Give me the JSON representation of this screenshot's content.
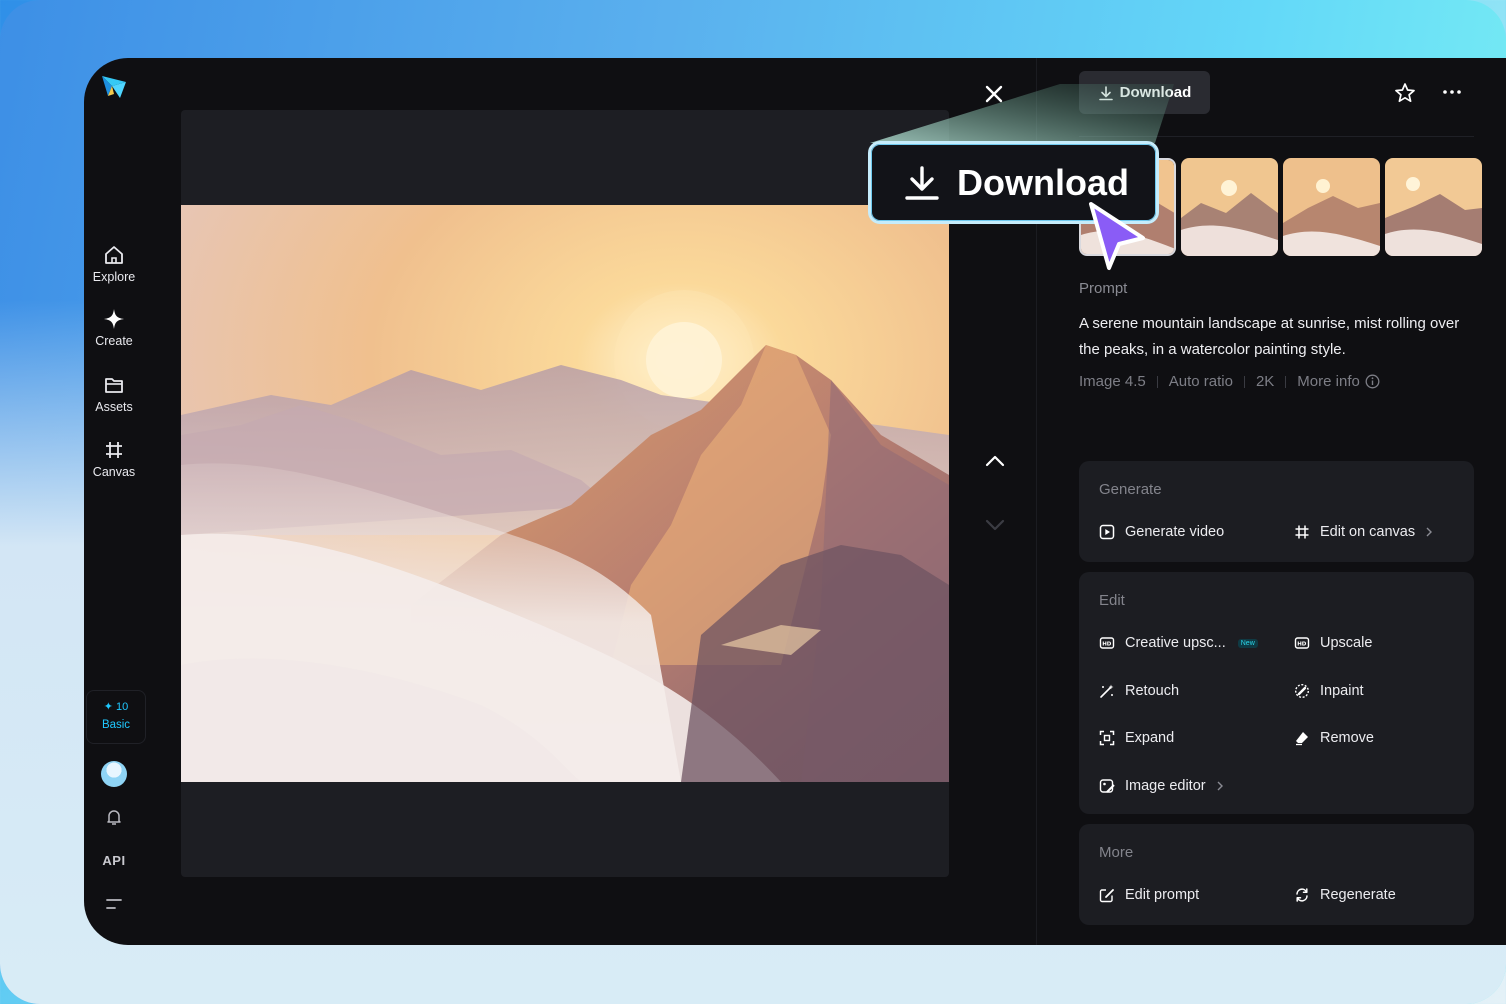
{
  "sidebar": {
    "items": [
      {
        "label": "Explore",
        "icon": "home-icon"
      },
      {
        "label": "Create",
        "icon": "sparkle-icon"
      },
      {
        "label": "Assets",
        "icon": "folder-icon"
      },
      {
        "label": "Canvas",
        "icon": "canvas-icon"
      }
    ],
    "credits_count": "10",
    "plan": "Basic",
    "api_label": "API"
  },
  "header": {
    "download_label": "Download"
  },
  "callout": {
    "download_label": "Download"
  },
  "prompt": {
    "label": "Prompt",
    "text": "A serene mountain landscape at sunrise, mist rolling over the peaks, in a watercolor painting style.",
    "model": "Image 4.5",
    "ratio": "Auto ratio",
    "resolution": "2K",
    "more_info": "More info"
  },
  "generate": {
    "title": "Generate",
    "items": [
      "Generate video",
      "Edit on canvas"
    ]
  },
  "edit": {
    "title": "Edit",
    "items": [
      "Creative upsc...",
      "Upscale",
      "Retouch",
      "Inpaint",
      "Expand",
      "Remove",
      "Image editor"
    ],
    "new_badge": "New"
  },
  "more": {
    "title": "More",
    "items": [
      "Edit prompt",
      "Regenerate"
    ]
  },
  "colors": {
    "accent": "#1fc8ff",
    "panel": "#1c1d22",
    "background": "#0f0f12"
  }
}
